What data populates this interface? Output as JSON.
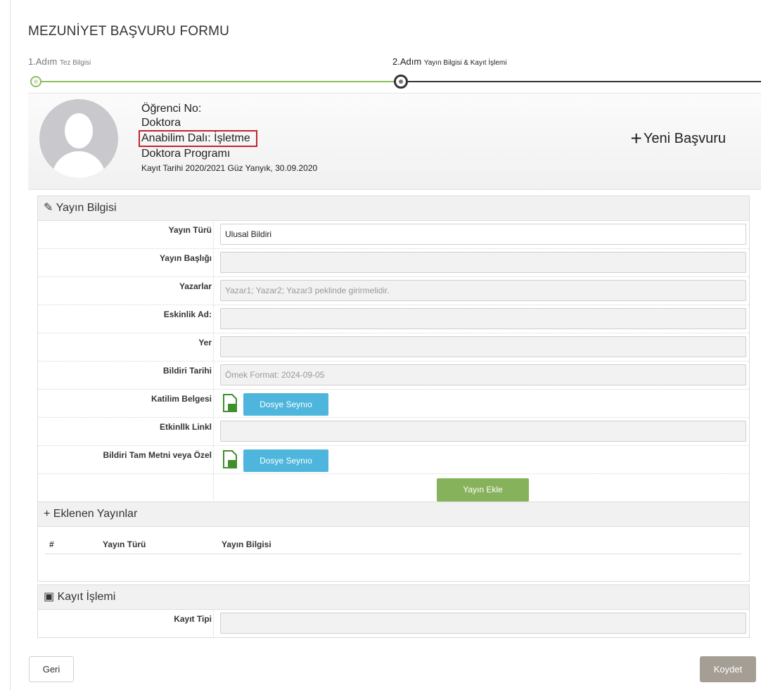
{
  "form": {
    "title": "MEZUNİYET BAŞVURU FORMU"
  },
  "steps": [
    {
      "label": "1.Adım",
      "sub": "Tez Bilgisi"
    },
    {
      "label": "2.Adım",
      "sub": "Yayın Bilgisi & Kayıt İşlemi"
    }
  ],
  "student": {
    "no_label": "Öğrenci No:",
    "level": "Doktora",
    "department": "Anabilim Dalı: İşletme",
    "program": "Doktora Programı",
    "registration": "Kayıt Tarihi 2020/2021 Güz Yanyık, 30.09.2020"
  },
  "new_application": {
    "icon": "plus-icon",
    "label": "Yeni Başvuru"
  },
  "publication_panel": {
    "icon": "pencil-icon",
    "title": "Yayın Bilgisi",
    "fields": {
      "type": {
        "label": "Yayın Türü",
        "value": "Ulusal Bildiri"
      },
      "title": {
        "label": "Yayın Başlığı",
        "value": ""
      },
      "authors": {
        "label": "Yazarlar",
        "placeholder": "Yazar1; Yazar2; Yazar3 peklinde girirmelidir."
      },
      "event_name": {
        "label": "Eskinlik Ad:",
        "value": ""
      },
      "place": {
        "label": "Yer",
        "value": ""
      },
      "date": {
        "label": "Bildiri Tarihi",
        "placeholder": "Ömek Format: 2024-09-05"
      },
      "participation": {
        "label": "Katilim Belgesi",
        "button": "Dosye Seynıo"
      },
      "event_link": {
        "label": "Etkinllk Linkl",
        "value": ""
      },
      "full_text": {
        "label": "Bildiri Tam Metni veya Özel",
        "button": "Dosye Seynıo"
      }
    },
    "add_button": "Yayın Ekle"
  },
  "added_panel": {
    "icon": "plus-icon",
    "title": "Eklenen Yayınlar",
    "columns": [
      "#",
      "Yayın Türü",
      "Yayın Bilgisi"
    ]
  },
  "record_panel": {
    "icon": "save-icon",
    "title": "Kayıt İşlemi",
    "type_label": "Kayıt Tipi"
  },
  "footer": {
    "back": "Geri",
    "save": "Koydet"
  },
  "colors": {
    "accent_green": "#86b25b",
    "button_blue": "#4eb6dc",
    "highlight_red": "#c0262d",
    "save_gray": "#a59e94"
  }
}
